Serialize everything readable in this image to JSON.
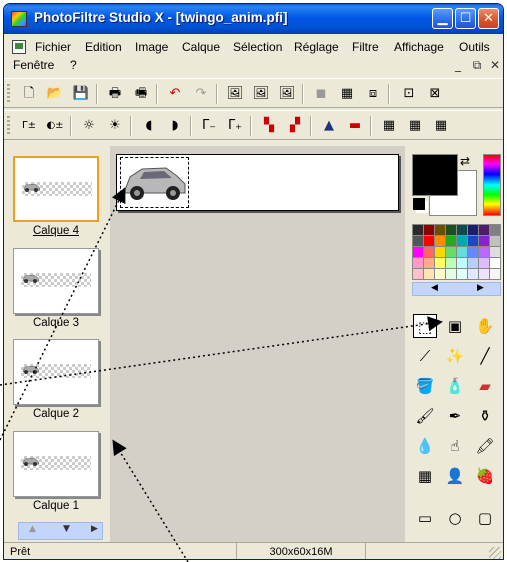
{
  "window": {
    "title": "PhotoFiltre Studio X - [twingo_anim.pfi]"
  },
  "menu": {
    "items": [
      "Fichier",
      "Edition",
      "Image",
      "Calque",
      "Sélection",
      "Réglage",
      "Filtre",
      "Affichage",
      "Outils"
    ],
    "row2": [
      "Fenêtre",
      "?"
    ]
  },
  "layers": [
    {
      "label": "Calque 4",
      "selected": true
    },
    {
      "label": "Calque 3",
      "selected": false
    },
    {
      "label": "Calque 2",
      "selected": false
    },
    {
      "label": "Calque 1",
      "selected": false
    }
  ],
  "status": {
    "left": "Prêt",
    "center": "300x60x16M"
  },
  "colors": {
    "foreground": "#000000",
    "background": "#ffffff",
    "palette": [
      "#2b2b2b",
      "#8b0000",
      "#6b4e00",
      "#1e4d1e",
      "#0e4b4b",
      "#1d1d6b",
      "#4b1d6b",
      "#808080",
      "#555555",
      "#ff0000",
      "#ff8c00",
      "#22aa22",
      "#00aaaa",
      "#2244cc",
      "#8822cc",
      "#c0c0c0",
      "#ff00ff",
      "#ff6666",
      "#ffd700",
      "#66dd66",
      "#66dddd",
      "#6688ff",
      "#bb66ff",
      "#dddddd",
      "#ff99cc",
      "#ffaa88",
      "#ffff66",
      "#bbffbb",
      "#bbffff",
      "#bbccff",
      "#ddbbff",
      "#ffffff",
      "#ffc0cb",
      "#ffe4b5",
      "#ffffcc",
      "#e0ffe0",
      "#e0ffff",
      "#e0e8ff",
      "#f0e0ff",
      "#f5f5f5"
    ]
  }
}
